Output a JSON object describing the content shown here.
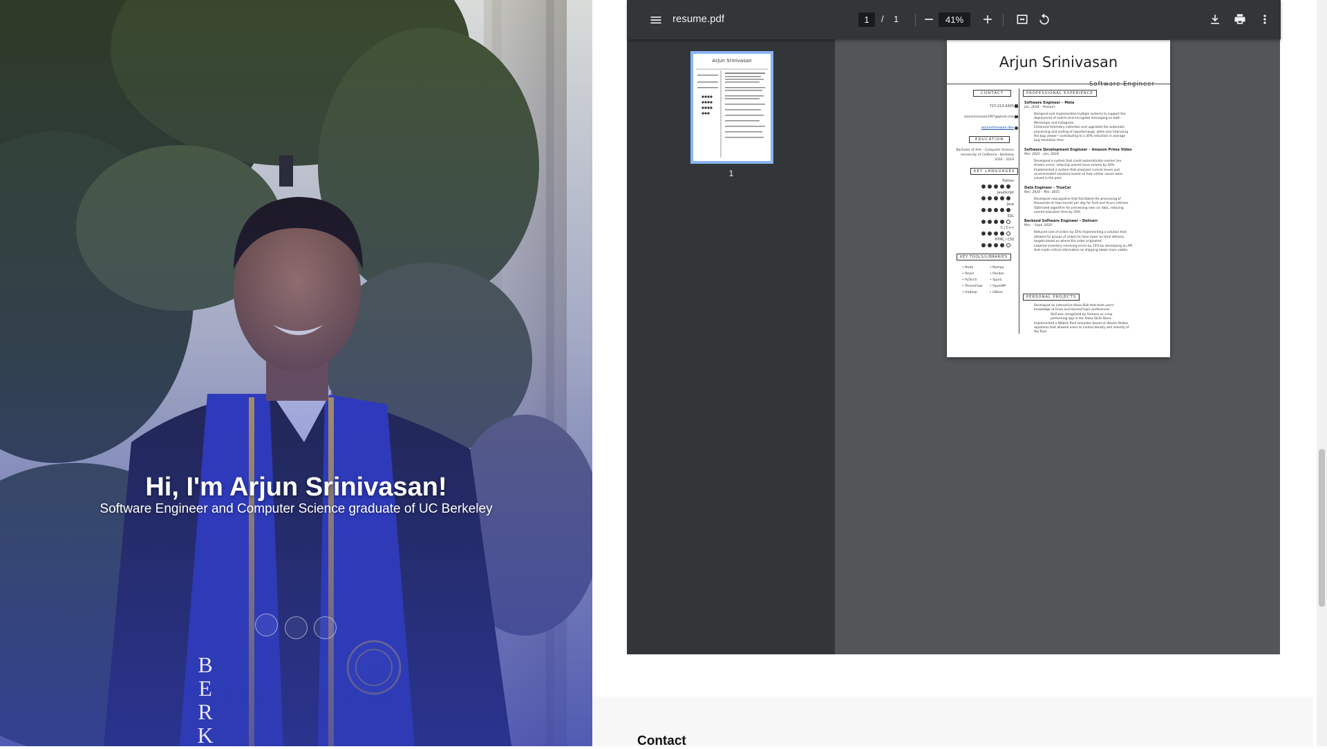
{
  "hero": {
    "title": "Hi, I'm Arjun Srinivasan!",
    "subtitle": "Software Engineer and Computer Science graduate of UC Berkeley",
    "overlay_color": "#2f3bb0",
    "stole_letters": "BERK"
  },
  "pdf_viewer": {
    "doc_title": "resume.pdf",
    "current_page": "1",
    "page_separator": "/",
    "total_pages": "1",
    "zoom": "41%",
    "thumbnail_label": "1",
    "icons": [
      "menu-icon",
      "zoom-out-icon",
      "zoom-in-icon",
      "fit-page-icon",
      "rotate-icon",
      "download-icon",
      "print-icon",
      "more-vert-icon"
    ]
  },
  "resume": {
    "name": "Arjun Srinivasan",
    "role": "Software Engineer",
    "sections": {
      "contact": "CONTACT",
      "experience": "PROFESSIONAL EXPERIENCE",
      "education": "EDUCATION",
      "languages": "KEY LANGUAGES",
      "tools": "KEY TOOLS/LIBRARIES",
      "projects": "PERSONAL PROJECTS"
    },
    "contact_phone": "727-213-4305",
    "contact_email": "arjunsrinivasan1997@gmail.com",
    "contact_site": "arjunsrinivasan.dev",
    "education": [
      "Bachelor of Arts - Computer Science",
      "University of California - Berkeley",
      "2016 - 2019"
    ],
    "languages": [
      {
        "name": "Python",
        "level": 5
      },
      {
        "name": "JavaScript",
        "level": 5
      },
      {
        "name": "Java",
        "level": 5
      },
      {
        "name": "SQL",
        "level": 4
      },
      {
        "name": "C / C++",
        "level": 4
      },
      {
        "name": "HTML / CSS",
        "level": 4
      }
    ],
    "tools_left": [
      "Node",
      "React",
      "PyTorch",
      "TensorFlow",
      "Hadoop"
    ],
    "tools_right": [
      "Numpy",
      "Pandas",
      "Spark",
      "OpenMP",
      "HBase"
    ],
    "jobs": [
      {
        "title": "Software Engineer – Meta",
        "dates": "Jan. 2024 – Present",
        "bullets": [
          "Designed and implemented multiple systems to support the",
          "deployment of end-to-end encrypted messaging on both",
          "Messenger and Instagram.",
          "Enhanced telemetry collection and upgraded the automatic",
          "processing and sorting of reported bugs, while also improving",
          "the bug viewer—contributing to a 30% reduction in average",
          "bug resolution time."
        ]
      },
      {
        "title": "Software Development Engineer – Amazon Prime Video",
        "dates": "Mar. 2021 – Jan. 2024",
        "bullets": [
          "Developed a system that could automatically resolve live",
          "stream errors, reducing overall issue volume by 20%.",
          "Implemented a system that analyzed current issues and",
          "recommended solutions based on how similar issues were",
          "solved in the past."
        ]
      },
      {
        "title": "Data Engineer – TrueCar",
        "dates": "Nov. 2020 – Mar. 2021",
        "bullets": [
          "Developed new pipeline that facilitated the processing of",
          "thousands of new records per day for Ford and Acura vehicles.",
          "Optimized algorithm for processing new car data, reducing",
          "overall execution time by 20%."
        ]
      },
      {
        "title": "Backend Software Engineer – Deliverr",
        "dates": "Mar. – Sept. 2020",
        "bullets": [
          "Reduced cost of orders by 25% implementing a solution that",
          "allowed for groups of orders to have lower on time delivery",
          "targets based on where the order originated.",
          "Lowered inventory receiving errors by 15% by developing an API",
          "that made critical information on shipping labels more visible."
        ]
      }
    ],
    "projects": [
      "Developed an interactive Alexa Skill that tests users'",
      "knowledge of trivia and learned topic preferences",
      "Skill was recognized by Amazon as a top",
      "performing app in the Alexa Skills Store.",
      "Implemented a WebGL fluid simulator based on Navier-Stokes",
      "equations that allowed users to control density and velocity of",
      "the fluid"
    ]
  },
  "contact_section": {
    "heading": "Contact"
  }
}
